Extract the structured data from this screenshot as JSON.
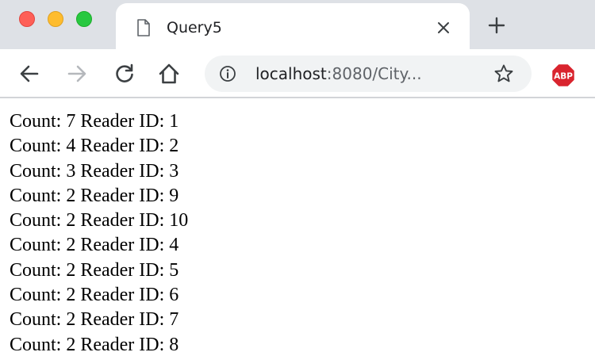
{
  "tab": {
    "title": "Query5"
  },
  "toolbar": {
    "url_host": "localhost",
    "url_rest": ":8080/City..."
  },
  "extensions": {
    "abp_label": "ABP"
  },
  "results": [
    {
      "count_label": "Count:",
      "count": "7",
      "reader_label": "Reader ID:",
      "reader_id": "1"
    },
    {
      "count_label": "Count:",
      "count": "4",
      "reader_label": "Reader ID:",
      "reader_id": "2"
    },
    {
      "count_label": "Count:",
      "count": "3",
      "reader_label": "Reader ID:",
      "reader_id": "3"
    },
    {
      "count_label": "Count:",
      "count": "2",
      "reader_label": "Reader ID:",
      "reader_id": "9"
    },
    {
      "count_label": "Count:",
      "count": "2",
      "reader_label": "Reader ID:",
      "reader_id": "10"
    },
    {
      "count_label": "Count:",
      "count": "2",
      "reader_label": "Reader ID:",
      "reader_id": "4"
    },
    {
      "count_label": "Count:",
      "count": "2",
      "reader_label": "Reader ID:",
      "reader_id": "5"
    },
    {
      "count_label": "Count:",
      "count": "2",
      "reader_label": "Reader ID:",
      "reader_id": "6"
    },
    {
      "count_label": "Count:",
      "count": "2",
      "reader_label": "Reader ID:",
      "reader_id": "7"
    },
    {
      "count_label": "Count:",
      "count": "2",
      "reader_label": "Reader ID:",
      "reader_id": "8"
    }
  ],
  "icons": {
    "close": "close-icon",
    "new_tab": "plus-icon",
    "back": "arrow-left-icon",
    "forward": "arrow-right-icon",
    "reload": "reload-icon",
    "home": "home-icon",
    "info": "info-icon",
    "bookmark": "star-icon",
    "page": "document-icon"
  },
  "colors": {
    "tabstrip": "#dee1e6",
    "omnibox": "#f1f3f4",
    "abp_red": "#d9242e",
    "traffic_red": "#fe5f57",
    "traffic_yellow": "#febc2e",
    "traffic_green": "#28c840"
  }
}
